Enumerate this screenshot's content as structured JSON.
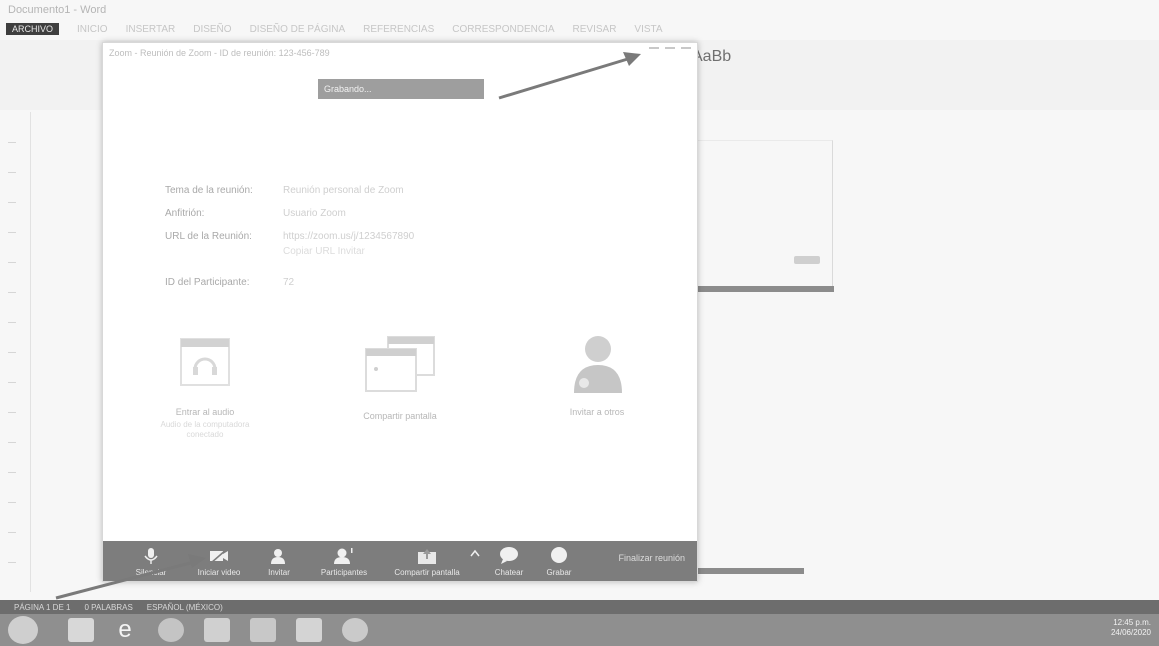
{
  "background_app": {
    "title": "Documento1 - Word",
    "file_tab": "ARCHIVO",
    "ribbon_tabs": [
      "INICIO",
      "INSERTAR",
      "DISEÑO",
      "DISEÑO DE PÁGINA",
      "REFERENCIAS",
      "CORRESPONDENCIA",
      "REVISAR",
      "VISTA"
    ],
    "abbr_label": "AaBb"
  },
  "zoom": {
    "window_title": "Zoom - Reunión de Zoom - ID de reunión: 123-456-789",
    "badge": "Grabando...",
    "info": {
      "topic_label": "Tema de la reunión:",
      "topic_value": "Reunión personal de Zoom",
      "host_label": "Anfitrión:",
      "host_value": "Usuario Zoom",
      "url_label": "URL de la Reunión:",
      "url_value": "https://zoom.us/j/1234567890",
      "url_value2": "Copiar URL    Invitar",
      "participant_label": "ID del Participante:",
      "participant_value": "72"
    },
    "features": [
      {
        "caption": "Entrar al audio",
        "sub": "Audio de la computadora conectado"
      },
      {
        "caption": "Compartir pantalla",
        "sub": ""
      },
      {
        "caption": "Invitar a otros",
        "sub": ""
      }
    ],
    "toolbar": {
      "mute": "Silenciar",
      "video": "Iniciar video",
      "invite": "Invitar",
      "participants": "Participantes",
      "share": "Compartir pantalla",
      "chat": "Chatear",
      "record": "Grabar",
      "end": "Finalizar reunión"
    }
  },
  "status_bar": [
    "PÁGINA 1 DE 1",
    "0 PALABRAS",
    "ESPAÑOL (MÉXICO)"
  ],
  "tray": {
    "time": "12:45 p.m.",
    "date": "24/06/2020"
  }
}
